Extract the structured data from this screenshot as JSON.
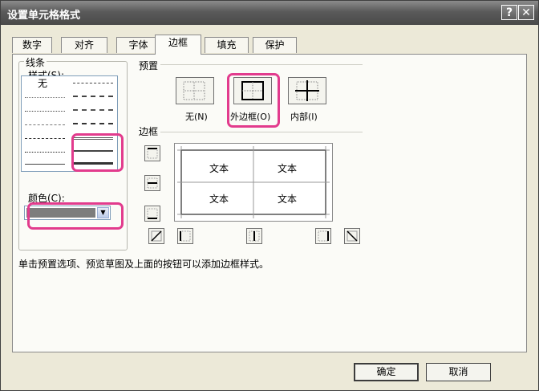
{
  "window": {
    "title": "设置单元格格式",
    "help_label": "?",
    "close_label": "✕"
  },
  "tabs": [
    {
      "label": "数字",
      "active": false
    },
    {
      "label": "对齐",
      "active": false
    },
    {
      "label": "字体",
      "active": false
    },
    {
      "label": "边框",
      "active": true
    },
    {
      "label": "填充",
      "active": false
    },
    {
      "label": "保护",
      "active": false
    }
  ],
  "line": {
    "group_label": "线条",
    "style_label": "样式(S):",
    "none_label": "无",
    "color_label": "颜色(C):",
    "color_value": "#7d7d7d"
  },
  "presets": {
    "group_label": "预置",
    "items": [
      {
        "label": "无(N)",
        "icon": "border-none-icon"
      },
      {
        "label": "外边框(O)",
        "icon": "border-outline-icon"
      },
      {
        "label": "内部(I)",
        "icon": "border-inside-icon"
      }
    ]
  },
  "border": {
    "group_label": "边框",
    "preview_cells": [
      "文本",
      "文本",
      "文本",
      "文本"
    ]
  },
  "hint": "单击预置选项、预览草图及上面的按钮可以添加边框样式。",
  "buttons": {
    "ok": "确定",
    "cancel": "取消"
  },
  "colors": {
    "highlight": "#e23b8d",
    "titlebar": "#5a5a5a"
  }
}
